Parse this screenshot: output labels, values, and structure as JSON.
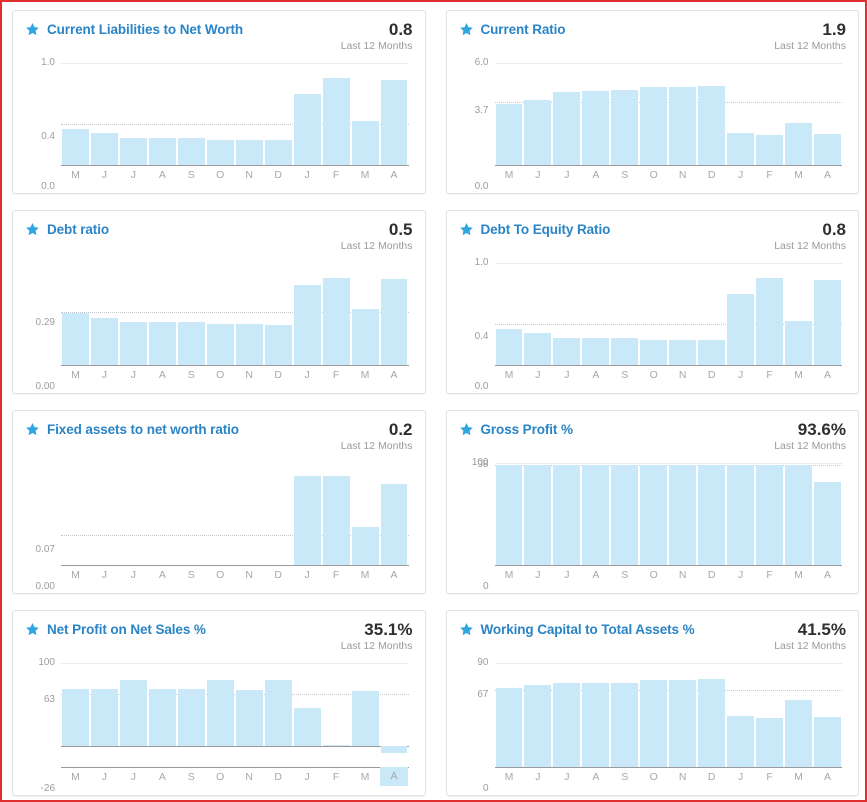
{
  "theme": {
    "accent": "#2a84c6",
    "bar_color": "#c9e8f8",
    "value_color": "#2f2f2f",
    "muted": "#9d9d9d",
    "page_border": "#e03030"
  },
  "common": {
    "period_label": "Last 12 Months",
    "star_icon": "star-icon",
    "months": [
      "M",
      "J",
      "J",
      "A",
      "S",
      "O",
      "N",
      "D",
      "J",
      "F",
      "M",
      "A"
    ]
  },
  "cards": [
    {
      "id": "current-liabilities-to-net-worth",
      "title": "Current Liabilities to Net Worth",
      "value": "0.8",
      "period": "Last 12 Months"
    },
    {
      "id": "current-ratio",
      "title": "Current Ratio",
      "value": "1.9",
      "period": "Last 12 Months"
    },
    {
      "id": "debt-ratio",
      "title": "Debt ratio",
      "value": "0.5",
      "period": "Last 12 Months"
    },
    {
      "id": "debt-to-equity-ratio",
      "title": "Debt To Equity Ratio",
      "value": "0.8",
      "period": "Last 12 Months"
    },
    {
      "id": "fixed-assets-to-net-worth-ratio",
      "title": "Fixed assets to net worth ratio",
      "value": "0.2",
      "period": "Last 12 Months"
    },
    {
      "id": "gross-profit-pct",
      "title": "Gross Profit %",
      "value": "93.6%",
      "period": "Last 12 Months"
    },
    {
      "id": "net-profit-on-net-sales-pct",
      "title": "Net Profit on Net Sales %",
      "value": "35.1%",
      "period": "Last 12 Months"
    },
    {
      "id": "working-capital-to-total-assets-pct",
      "title": "Working Capital to Total Assets %",
      "value": "41.5%",
      "period": "Last 12 Months"
    }
  ],
  "chart_data": [
    {
      "id": "current-liabilities-to-net-worth",
      "type": "bar",
      "title": "Current Liabilities to Net Worth",
      "xlabel": "",
      "ylabel": "",
      "categories": [
        "M",
        "J",
        "J",
        "A",
        "S",
        "O",
        "N",
        "D",
        "J",
        "F",
        "M",
        "A"
      ],
      "values": [
        0.35,
        0.31,
        0.26,
        0.26,
        0.26,
        0.25,
        0.25,
        0.25,
        0.7,
        0.85,
        0.43,
        0.83
      ],
      "ylim": [
        0.0,
        1.0
      ],
      "yticks": [
        0.0,
        0.4,
        1.0
      ],
      "ytick_labels": [
        "0.0",
        "0.4",
        "1.0"
      ],
      "reference_line": 0.4,
      "grid": true,
      "legend": "none"
    },
    {
      "id": "current-ratio",
      "type": "bar",
      "title": "Current Ratio",
      "xlabel": "",
      "ylabel": "",
      "categories": [
        "M",
        "J",
        "J",
        "A",
        "S",
        "O",
        "N",
        "D",
        "J",
        "F",
        "M",
        "A"
      ],
      "values": [
        3.6,
        3.8,
        4.3,
        4.35,
        4.4,
        4.6,
        4.6,
        4.65,
        1.9,
        1.75,
        2.5,
        1.85
      ],
      "ylim": [
        0.0,
        6.0
      ],
      "yticks": [
        0.0,
        3.7,
        6.0
      ],
      "ytick_labels": [
        "0.0",
        "3.7",
        "6.0"
      ],
      "reference_line": 3.7,
      "grid": true,
      "legend": "none"
    },
    {
      "id": "debt-ratio",
      "type": "bar",
      "title": "Debt ratio",
      "xlabel": "",
      "ylabel": "",
      "categories": [
        "M",
        "J",
        "J",
        "A",
        "S",
        "O",
        "N",
        "D",
        "J",
        "F",
        "M",
        "A"
      ],
      "values": [
        0.285,
        0.26,
        0.235,
        0.235,
        0.235,
        0.225,
        0.225,
        0.22,
        0.44,
        0.48,
        0.31,
        0.47
      ],
      "ylim": [
        0.0,
        0.56
      ],
      "yticks": [
        0.0,
        0.29
      ],
      "ytick_labels": [
        "0.00",
        "0.29"
      ],
      "reference_line": 0.29,
      "grid": true,
      "legend": "none"
    },
    {
      "id": "debt-to-equity-ratio",
      "type": "bar",
      "title": "Debt To Equity Ratio",
      "xlabel": "",
      "ylabel": "",
      "categories": [
        "M",
        "J",
        "J",
        "A",
        "S",
        "O",
        "N",
        "D",
        "J",
        "F",
        "M",
        "A"
      ],
      "values": [
        0.35,
        0.31,
        0.26,
        0.26,
        0.26,
        0.25,
        0.25,
        0.25,
        0.7,
        0.85,
        0.43,
        0.83
      ],
      "ylim": [
        0.0,
        1.0
      ],
      "yticks": [
        0.0,
        0.4,
        1.0
      ],
      "ytick_labels": [
        "0.0",
        "0.4",
        "1.0"
      ],
      "reference_line": 0.4,
      "grid": true,
      "legend": "none"
    },
    {
      "id": "fixed-assets-to-net-worth-ratio",
      "type": "bar",
      "title": "Fixed assets to net worth ratio",
      "xlabel": "",
      "ylabel": "",
      "categories": [
        "M",
        "J",
        "J",
        "A",
        "S",
        "O",
        "N",
        "D",
        "J",
        "F",
        "M",
        "A"
      ],
      "values": [
        0,
        0,
        0,
        0,
        0,
        0,
        0,
        0,
        0.205,
        0.205,
        0.088,
        0.186
      ],
      "ylim": [
        0.0,
        0.235
      ],
      "yticks": [
        0.0,
        0.07
      ],
      "ytick_labels": [
        "0.00",
        "0.07"
      ],
      "reference_line": 0.07,
      "grid": true,
      "legend": "none"
    },
    {
      "id": "gross-profit-pct",
      "type": "bar",
      "title": "Gross Profit %",
      "xlabel": "",
      "ylabel": "",
      "categories": [
        "M",
        "J",
        "J",
        "A",
        "S",
        "O",
        "N",
        "D",
        "J",
        "F",
        "M",
        "A"
      ],
      "values": [
        98,
        98,
        98,
        98,
        98,
        98,
        98,
        98,
        98,
        98,
        98,
        81
      ],
      "ylim": [
        0,
        100
      ],
      "yticks": [
        0,
        98,
        100
      ],
      "ytick_labels": [
        "0",
        "98",
        "100"
      ],
      "reference_line": 98,
      "grid": true,
      "legend": "none"
    },
    {
      "id": "net-profit-on-net-sales-pct",
      "type": "bar",
      "title": "Net Profit on Net Sales %",
      "xlabel": "",
      "ylabel": "",
      "categories": [
        "M",
        "J",
        "J",
        "A",
        "S",
        "O",
        "N",
        "D",
        "J",
        "F",
        "M",
        "A"
      ],
      "values": [
        68,
        68,
        79,
        68,
        68,
        80,
        67,
        79,
        45,
        1,
        66,
        -9
      ],
      "ylim": [
        -26,
        100
      ],
      "yticks": [
        -26,
        63,
        100
      ],
      "ytick_labels": [
        "-26",
        "63",
        "100"
      ],
      "reference_line": 63,
      "zero_line": 0,
      "grid": true,
      "legend": "none"
    },
    {
      "id": "working-capital-to-total-assets-pct",
      "type": "bar",
      "title": "Working Capital to Total Assets %",
      "xlabel": "",
      "ylabel": "",
      "categories": [
        "M",
        "J",
        "J",
        "A",
        "S",
        "O",
        "N",
        "D",
        "J",
        "F",
        "M",
        "A"
      ],
      "values": [
        68,
        71,
        73,
        73,
        73,
        75,
        75,
        76,
        44,
        42,
        58,
        43
      ],
      "ylim": [
        0,
        90
      ],
      "yticks": [
        0,
        67,
        90
      ],
      "ytick_labels": [
        "0",
        "67",
        "90"
      ],
      "reference_line": 67,
      "grid": true,
      "legend": "none"
    }
  ]
}
